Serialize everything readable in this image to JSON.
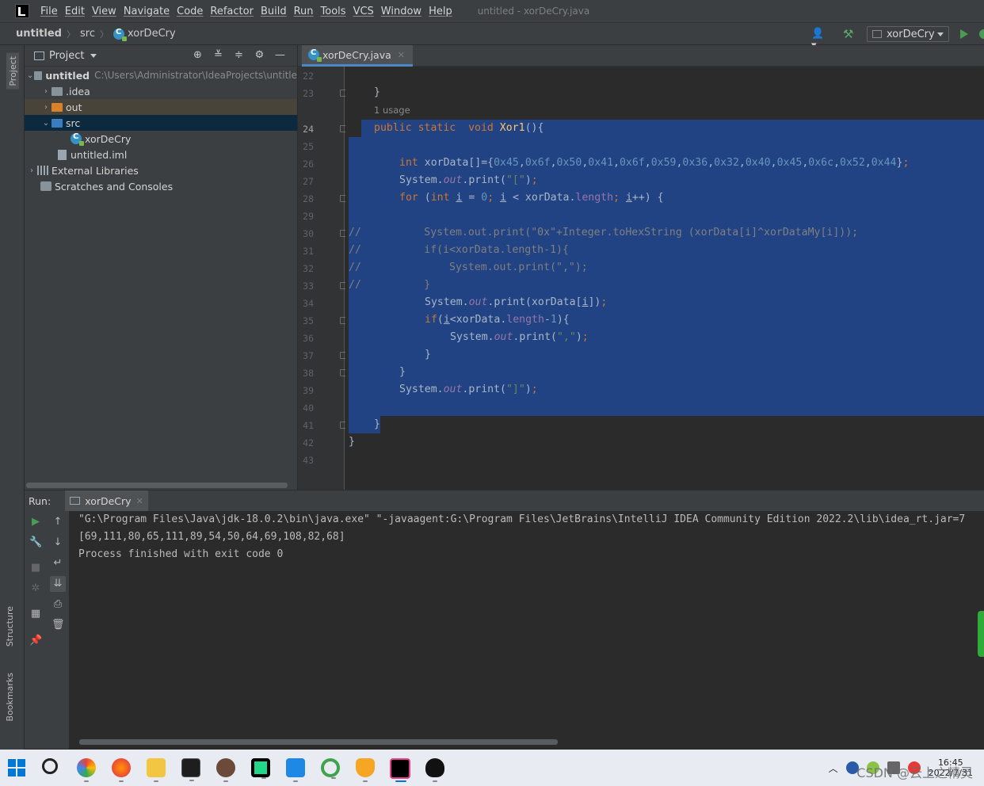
{
  "menu": {
    "items": [
      "File",
      "Edit",
      "View",
      "Navigate",
      "Code",
      "Refactor",
      "Build",
      "Run",
      "Tools",
      "VCS",
      "Window",
      "Help"
    ],
    "window_title": "untitled - xorDeCry.java"
  },
  "navbar": {
    "crumbs": [
      "untitled",
      "src",
      "xorDeCry"
    ],
    "run_config": "xorDeCry"
  },
  "stripe": {
    "project": "Project",
    "structure": "Structure",
    "bookmarks": "Bookmarks"
  },
  "project_panel": {
    "title": "Project",
    "tree": [
      {
        "label": "untitled",
        "path": "C:\\Users\\Administrator\\IdeaProjects\\untitle"
      },
      {
        "label": ".idea"
      },
      {
        "label": "out"
      },
      {
        "label": "src"
      },
      {
        "label": "xorDeCry"
      },
      {
        "label": "untitled.iml"
      },
      {
        "label": "External Libraries"
      },
      {
        "label": "Scratches and Consoles"
      }
    ]
  },
  "editor": {
    "tab_label": "xorDeCry.java",
    "usage_hint": "1 usage",
    "current_line": 24,
    "line_numbers": [
      "22",
      "23",
      "24",
      "25",
      "26",
      "27",
      "28",
      "29",
      "30",
      "31",
      "32",
      "33",
      "34",
      "35",
      "36",
      "37",
      "38",
      "39",
      "40",
      "41",
      "42",
      "43"
    ]
  },
  "run_panel": {
    "title": "Run:",
    "tab_label": "xorDeCry",
    "console": [
      "\"G:\\Program Files\\Java\\jdk-18.0.2\\bin\\java.exe\" \"-javaagent:G:\\Program Files\\JetBrains\\IntelliJ IDEA Community Edition 2022.2\\lib\\idea_rt.jar=7",
      "[69,111,80,65,111,89,54,50,64,69,108,82,68]",
      "Process finished with exit code 0"
    ]
  },
  "taskbar": {
    "clock_time": "16:45",
    "clock_date": "2022/7/31",
    "watermark": "CSDN @云上之精灵"
  },
  "colors": {
    "selection": "#214283",
    "keyword": "#cc7832",
    "number": "#6897bb",
    "string": "#6a8759",
    "field": "#9876aa",
    "method": "#ffc66d"
  }
}
